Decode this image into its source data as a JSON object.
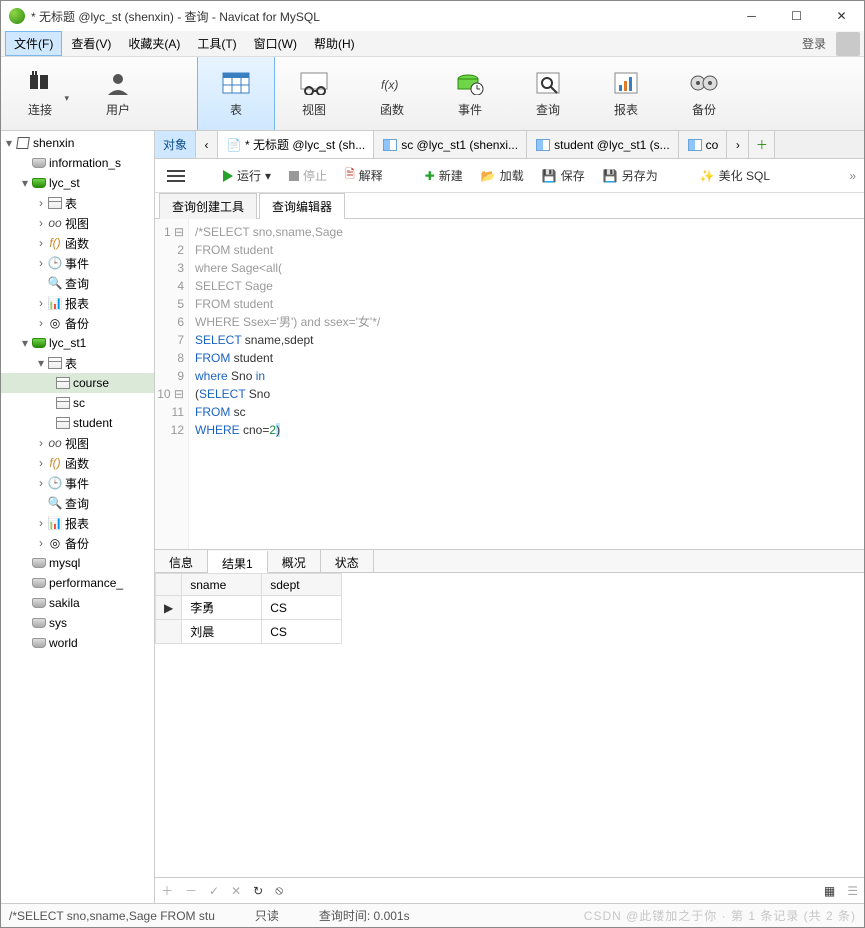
{
  "window": {
    "title": "* 无标题 @lyc_st (shenxin) - 查询 - Navicat for MySQL"
  },
  "menu": {
    "items": [
      "文件(F)",
      "查看(V)",
      "收藏夹(A)",
      "工具(T)",
      "窗口(W)",
      "帮助(H)"
    ],
    "login": "登录"
  },
  "toolbar": {
    "items": [
      "连接",
      "用户",
      "表",
      "视图",
      "函数",
      "事件",
      "查询",
      "报表",
      "备份"
    ],
    "active": "表"
  },
  "tree": {
    "conn": "shenxin",
    "db1": "information_s",
    "lyc_st": {
      "name": "lyc_st",
      "children": [
        "表",
        "视图",
        "函数",
        "事件",
        "查询",
        "报表",
        "备份"
      ]
    },
    "lyc_st1": {
      "name": "lyc_st1",
      "tables_label": "表",
      "tables": [
        "course",
        "sc",
        "student"
      ],
      "rest": [
        "视图",
        "函数",
        "事件",
        "查询",
        "报表",
        "备份"
      ]
    },
    "other": [
      "mysql",
      "performance_",
      "sakila",
      "sys",
      "world"
    ]
  },
  "tabs": {
    "object": "对象",
    "list": [
      {
        "label": "* 无标题 @lyc_st (sh...",
        "active": true
      },
      {
        "label": "sc @lyc_st1 (shenxi..."
      },
      {
        "label": "student @lyc_st1 (s..."
      },
      {
        "label": "co"
      }
    ]
  },
  "editorbar": {
    "run": "运行",
    "stop": "停止",
    "explain": "解释",
    "new": "新建",
    "load": "加载",
    "save": "保存",
    "saveas": "另存为",
    "beautify": "美化 SQL"
  },
  "subtabs": {
    "builder": "查询创建工具",
    "editor": "查询编辑器"
  },
  "code": {
    "lines": [
      {
        "t": "cm",
        "s": "/*SELECT sno,sname,Sage"
      },
      {
        "t": "cm",
        "s": "FROM student"
      },
      {
        "t": "cm",
        "s": "where Sage<all("
      },
      {
        "t": "cm",
        "s": "SELECT Sage"
      },
      {
        "t": "cm",
        "s": "FROM student"
      },
      {
        "t": "cm",
        "s": "WHERE Ssex='男') and ssex='女'*/"
      },
      {
        "t": "sql1"
      },
      {
        "t": "sql2"
      },
      {
        "t": "sql3"
      },
      {
        "t": "sql4"
      },
      {
        "t": "sql5"
      },
      {
        "t": "sql6"
      }
    ],
    "kw": {
      "select": "SELECT",
      "from": "FROM",
      "where": "where",
      "in": "in",
      "WHERE": "WHERE"
    },
    "ids": {
      "l7": " sname,sdept",
      "l8": " student",
      "l9": " Sno ",
      "l10a": "(",
      "l10b": " Sno",
      "l11": " sc",
      "l12a": " cno=",
      "l12b": "2",
      "l12c": ")"
    }
  },
  "lowtabs": {
    "info": "信息",
    "result": "结果1",
    "profile": "概况",
    "status": "状态"
  },
  "grid": {
    "cols": [
      "sname",
      "sdept"
    ],
    "rows": [
      {
        "sname": "李勇",
        "sdept": "CS",
        "cur": true
      },
      {
        "sname": "刘晨",
        "sdept": "CS"
      }
    ]
  },
  "status": {
    "sql": "/*SELECT sno,sname,Sage FROM stu",
    "mode": "只读",
    "time": "查询时间: 0.001s",
    "rec": "第 1 条记录 (共 2 条)",
    "wm": "CSDN @此镂加之于你"
  }
}
